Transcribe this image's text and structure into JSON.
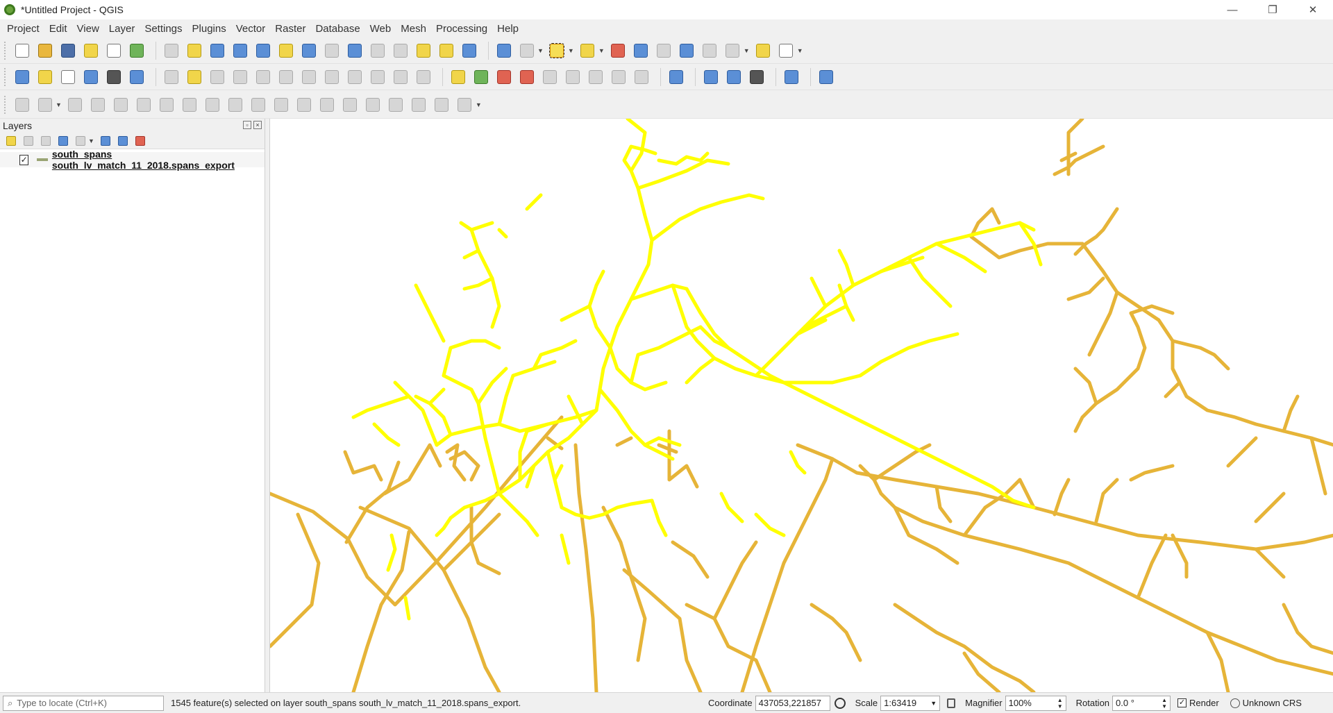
{
  "window": {
    "title": "*Untitled Project - QGIS",
    "min_glyph": "—",
    "max_glyph": "❐",
    "close_glyph": "✕"
  },
  "menu": [
    "Project",
    "Edit",
    "View",
    "Layer",
    "Settings",
    "Plugins",
    "Vector",
    "Raster",
    "Database",
    "Web",
    "Mesh",
    "Processing",
    "Help"
  ],
  "layers_panel": {
    "title": "Layers",
    "layer": {
      "name": "south_spans south_lv_match_11_2018.spans_export",
      "checked_glyph": "✓"
    }
  },
  "colors": {
    "selected_feature": "#ffff00",
    "feature": "#e6b438"
  },
  "status": {
    "locator_placeholder": "Type to locate (Ctrl+K)",
    "message": "1545 feature(s) selected on layer south_spans south_lv_match_11_2018.spans_export.",
    "coordinate_label": "Coordinate",
    "coordinate_value": "437053,221857",
    "scale_label": "Scale",
    "scale_value": "1:63419",
    "magnifier_label": "Magnifier",
    "magnifier_value": "100%",
    "rotation_label": "Rotation",
    "rotation_value": "0.0 °",
    "render_label": "Render",
    "render_checked_glyph": "✓",
    "crs_label": "Unknown CRS"
  }
}
